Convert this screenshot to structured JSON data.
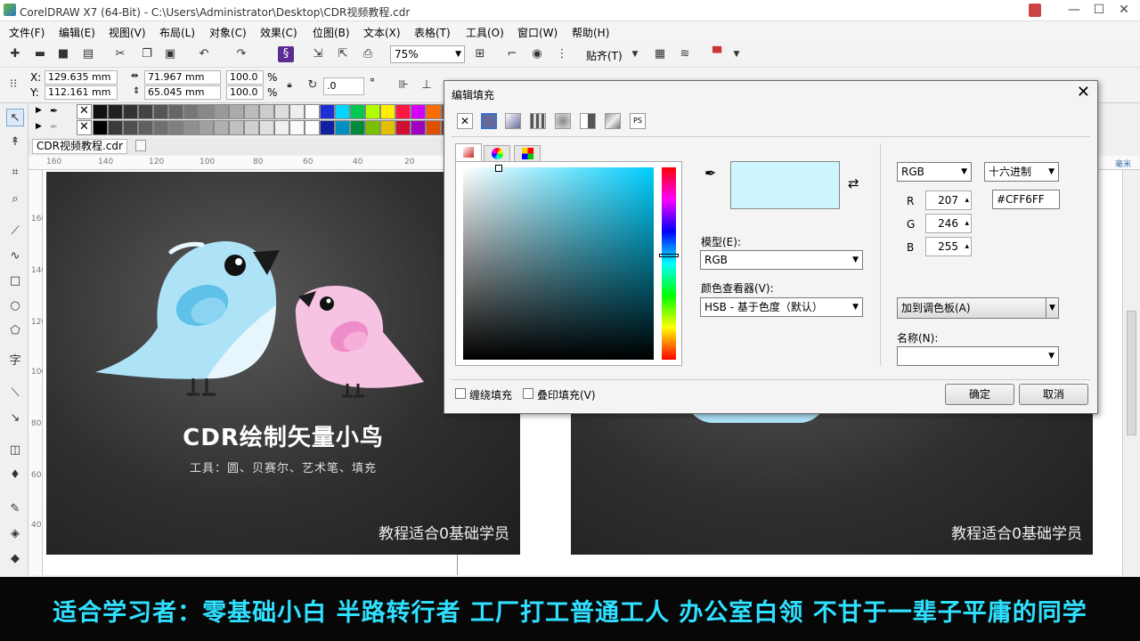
{
  "window": {
    "title": "CorelDRAW X7 (64-Bit) - C:\\Users\\Administrator\\Desktop\\CDR视频教程.cdr",
    "minimize_glyph": "—",
    "restore_glyph": "☐",
    "close_glyph": "✕"
  },
  "menu": [
    "文件(F)",
    "编辑(E)",
    "视图(V)",
    "布局(L)",
    "对象(C)",
    "效果(C)",
    "位图(B)",
    "文本(X)",
    "表格(T)",
    "工具(O)",
    "窗口(W)",
    "帮助(H)"
  ],
  "toolbar": {
    "zoom": "75%",
    "snap": "贴齐(T)"
  },
  "property_bar": {
    "x_label": "X:",
    "x": "129.635 mm",
    "y_label": "Y:",
    "y": "112.161 mm",
    "w": "71.967 mm",
    "h": "65.045 mm",
    "sx": "100.0",
    "sy": "100.0",
    "pct1": "%",
    "pct2": "%",
    "angle": ".0",
    "deg": "°"
  },
  "document_tab": "CDR视频教程.cdr",
  "ruler": {
    "h": [
      "160",
      "140",
      "120",
      "100",
      "80",
      "60",
      "40",
      "20"
    ],
    "v": [
      "160",
      "140",
      "120",
      "100",
      "80",
      "60",
      "40"
    ],
    "unit": "毫米"
  },
  "palette_colors": [
    "#111111",
    "#222222",
    "#333333",
    "#444444",
    "#555555",
    "#666666",
    "#777777",
    "#888888",
    "#999999",
    "#aaaaaa",
    "#bbbbbb",
    "#cccccc",
    "#dddddd",
    "#eeeeee",
    "#ffffff",
    "#1e2ed6",
    "#00d4ff",
    "#00c853",
    "#b2ff00",
    "#ffee00",
    "#ff1744",
    "#d500f9",
    "#ff6d00",
    "#a0522d",
    "#6a3d9a",
    "#b0b0e0"
  ],
  "palette_colors_2": [
    "#000000",
    "#3a3a3a",
    "#505050",
    "#606060",
    "#707070",
    "#808080",
    "#909090",
    "#a0a0a0",
    "#b0b0b0",
    "#c0c0c0",
    "#d0d0d0",
    "#e0e0e0",
    "#f0f0f0",
    "#fafafa",
    "#ffffff",
    "#101ea0",
    "#0090c0",
    "#008a3a",
    "#7ac000",
    "#e0c000",
    "#d01030",
    "#a000c0",
    "#e05000",
    "#804020",
    "#402070",
    "#8888cc"
  ],
  "canvas": {
    "card1_title": "CDR绘制矢量小鸟",
    "card1_subtitle": "工具：圆、贝赛尔、艺术笔、填充",
    "card1_footer": "教程适合0基础学员",
    "card2_footer": "教程适合0基础学员"
  },
  "dialog": {
    "title": "编辑填充",
    "close": "✕",
    "model_label": "模型(E):",
    "model_value": "RGB",
    "viewer_label": "颜色查看器(V):",
    "viewer_value": "HSB - 基于色度（默认）",
    "color_model": "RGB",
    "format": "十六进制",
    "r_label": "R",
    "r": "207",
    "g_label": "G",
    "g": "246",
    "b_label": "B",
    "b": "255",
    "hex": "#CFF6FF",
    "add_palette": "加到调色板(A)",
    "name_label": "名称(N):",
    "wrap_fill": "缠绕填充",
    "overprint": "叠印填充(V)",
    "ok": "确定",
    "cancel": "取消",
    "preview_color": "#cff6ff"
  },
  "banner": {
    "text": "适合学习者：零基础小白 半路转行者 工厂打工普通工人 办公室白领 不甘于一辈子平庸的同学"
  }
}
